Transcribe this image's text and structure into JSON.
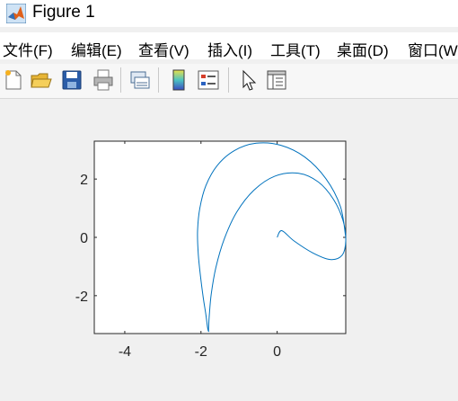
{
  "window": {
    "title": "Figure 1"
  },
  "menu": [
    {
      "label": "文件(F)"
    },
    {
      "label": "编辑(E)"
    },
    {
      "label": "查看(V)"
    },
    {
      "label": "插入(I)"
    },
    {
      "label": "工具(T)"
    },
    {
      "label": "桌面(D)"
    },
    {
      "label": "窗口(W)"
    }
  ],
  "toolbar": {
    "buttons": [
      {
        "icon": "new-figure-icon"
      },
      {
        "icon": "open-file-icon"
      },
      {
        "icon": "save-icon"
      },
      {
        "icon": "print-icon"
      },
      {
        "icon": "link-plot-icon"
      },
      {
        "icon": "insert-colorbar-icon"
      },
      {
        "icon": "insert-legend-icon"
      },
      {
        "icon": "edit-plot-pointer-icon"
      },
      {
        "icon": "property-inspector-icon"
      }
    ]
  },
  "chart_data": {
    "type": "line",
    "description_of_curve": "limacon with inner loop (parametric closed curve)",
    "series": [
      {
        "x": [
          1.8,
          1.66,
          1.28,
          0.73,
          0.09,
          -0.55,
          -1.12,
          -1.57,
          -1.87,
          -2.03,
          -2.09,
          -2.07,
          -2.01,
          -1.94,
          -1.87,
          -1.83,
          -1.8,
          -1.8,
          -1.78,
          -1.73,
          -1.61,
          -1.39,
          -1.06,
          -0.61,
          -0.06,
          0.55,
          1.08,
          1.48,
          1.73,
          1.8,
          1.7,
          1.39,
          0.93,
          0.44,
          0.12,
          0.0
        ],
        "y": [
          0.0,
          1.06,
          2.01,
          2.75,
          3.16,
          3.23,
          2.98,
          2.47,
          1.78,
          1.0,
          0.2,
          -0.59,
          -1.36,
          -2.07,
          -2.66,
          -3.07,
          -3.23,
          -3.09,
          -2.65,
          -1.94,
          -1.04,
          -0.06,
          0.87,
          1.62,
          2.1,
          2.2,
          1.9,
          1.3,
          0.57,
          -0.12,
          -0.62,
          -0.76,
          -0.53,
          -0.12,
          0.23,
          0.0
        ]
      }
    ],
    "xlim": [
      -4.8,
      1.8
    ],
    "ylim": [
      -3.3,
      3.3
    ],
    "xticks": [
      -4,
      -2,
      0
    ],
    "yticks": [
      2,
      0,
      -2
    ],
    "xtick_labels": [
      "-4",
      "-2",
      "0"
    ],
    "ytick_labels": [
      "2",
      "0",
      "-2"
    ],
    "line_color": "#0072bd",
    "grid": false,
    "legend": false
  }
}
